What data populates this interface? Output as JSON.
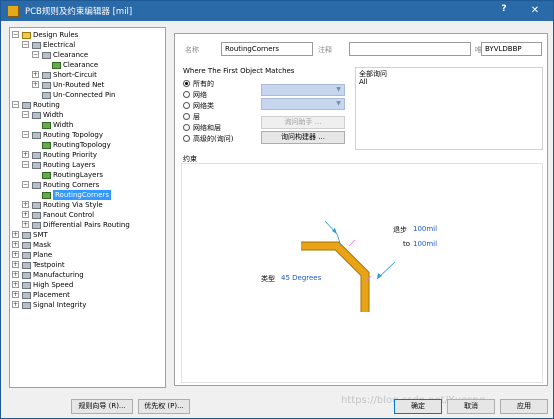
{
  "window": {
    "title": "PCB规则及约束编辑器 [mil]",
    "help": "?",
    "close": "✕"
  },
  "tree": {
    "root": "Design Rules",
    "electrical": "Electrical",
    "clearance_cat": "Clearance",
    "clearance_rule": "Clearance",
    "short_circuit": "Short-Circuit",
    "unrouted_net": "Un-Routed Net",
    "unconnected_pin": "Un-Connected Pin",
    "routing": "Routing",
    "width_cat": "Width",
    "width_rule": "Width",
    "routing_topology_cat": "Routing Topology",
    "routing_topology_rule": "RoutingTopology",
    "routing_priority": "Routing Priority",
    "routing_layers_cat": "Routing Layers",
    "routing_layers_rule": "RoutingLayers",
    "routing_corners_cat": "Routing Corners",
    "routing_corners_rule": "RoutingCorners",
    "routing_via_style": "Routing Via Style",
    "fanout_control": "Fanout Control",
    "diff_pairs": "Differential Pairs Routing",
    "smt": "SMT",
    "mask": "Mask",
    "plane": "Plane",
    "testpoint": "Testpoint",
    "manufacturing": "Manufacturing",
    "high_speed": "High Speed",
    "placement": "Placement",
    "signal_integrity": "Signal Integrity"
  },
  "form": {
    "name_label": "名称",
    "name_value": "RoutingCorners",
    "comment_label": "注释",
    "comment_value": "",
    "uid_label": "唯一ID",
    "uid_value": "BYVLDBBP"
  },
  "match": {
    "title": "Where The First Object Matches",
    "options": [
      "所有的",
      "网络",
      "网络类",
      "层",
      "网络和层",
      "高级的(询问)"
    ],
    "query_helper": "询问助手 ...",
    "query_builder": "询问构建器 ..."
  },
  "full_query": {
    "title": "全部询问",
    "text": "All"
  },
  "constraints": {
    "title": "约束",
    "type_label": "类型",
    "type_value": "45 Degrees",
    "step_label": "退步",
    "step_value": "100mil",
    "to_label": "to",
    "to_value": "100mil"
  },
  "footer": {
    "rule_wizard": "规则向导 (R)...",
    "priority": "优先权 (P)...",
    "ok": "确定",
    "cancel": "取消",
    "apply": "应用"
  },
  "watermark": "https://blog.csdn.net/Xuesng",
  "colors": {
    "titlebar": "#2b6aa8",
    "selection": "#3399ff",
    "trace": "#e8a317",
    "value_text": "#1c58c8"
  }
}
